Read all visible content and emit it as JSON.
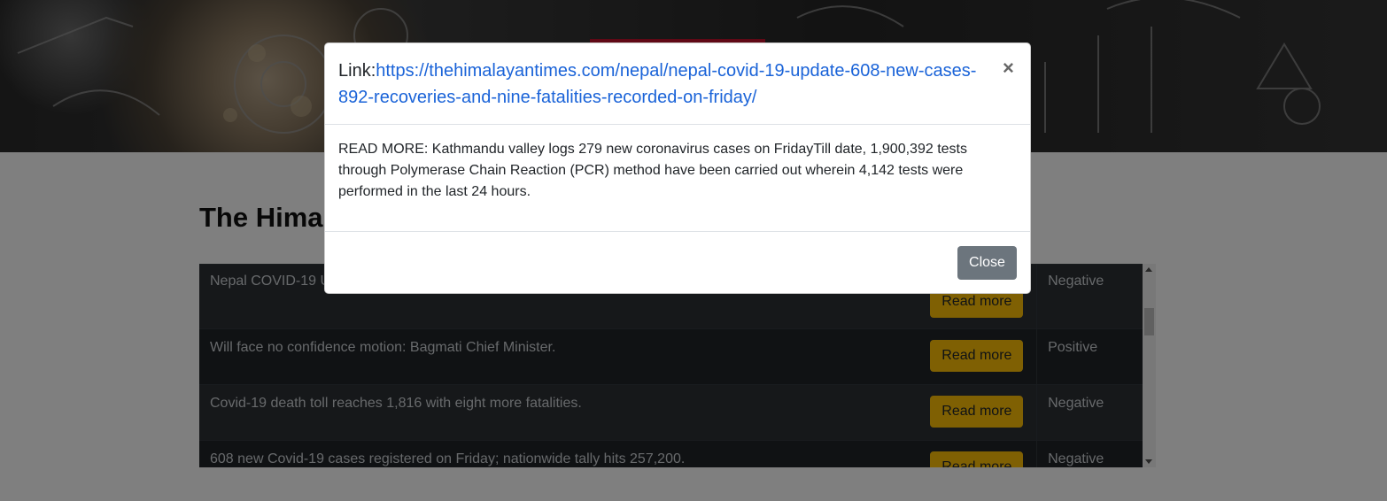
{
  "page": {
    "title": "The Hima"
  },
  "table": {
    "rows": [
      {
        "title": "Nepal COVID-19 U",
        "action": "Read more",
        "sentiment": "Negative"
      },
      {
        "title": "Will face no confidence motion: Bagmati Chief Minister.",
        "action": "Read more",
        "sentiment": "Positive"
      },
      {
        "title": "Covid-19 death toll reaches 1,816 with eight more fatalities.",
        "action": "Read more",
        "sentiment": "Negative"
      },
      {
        "title": "608 new Covid-19 cases registered on Friday; nationwide tally hits 257,200.",
        "action": "Read more",
        "sentiment": "Negative"
      }
    ]
  },
  "modal": {
    "link_label": "Link:",
    "link_url": "https://thehimalayantimes.com/nepal/nepal-covid-19-update-608-new-cases-892-recoveries-and-nine-fatalities-recorded-on-friday/",
    "close_icon": "×",
    "body": "READ MORE: Kathmandu valley logs 279 new coronavirus cases on FridayTill date, 1,900,392 tests through Polymerase Chain Reaction (PCR) method have been carried out wherein 4,142 tests were performed in the last 24 hours.",
    "close_button": "Close"
  },
  "colors": {
    "accent_read_more": "#ffc107",
    "link": "#1a63d8",
    "table_bg": "#212529",
    "close_button": "#6c757d"
  }
}
